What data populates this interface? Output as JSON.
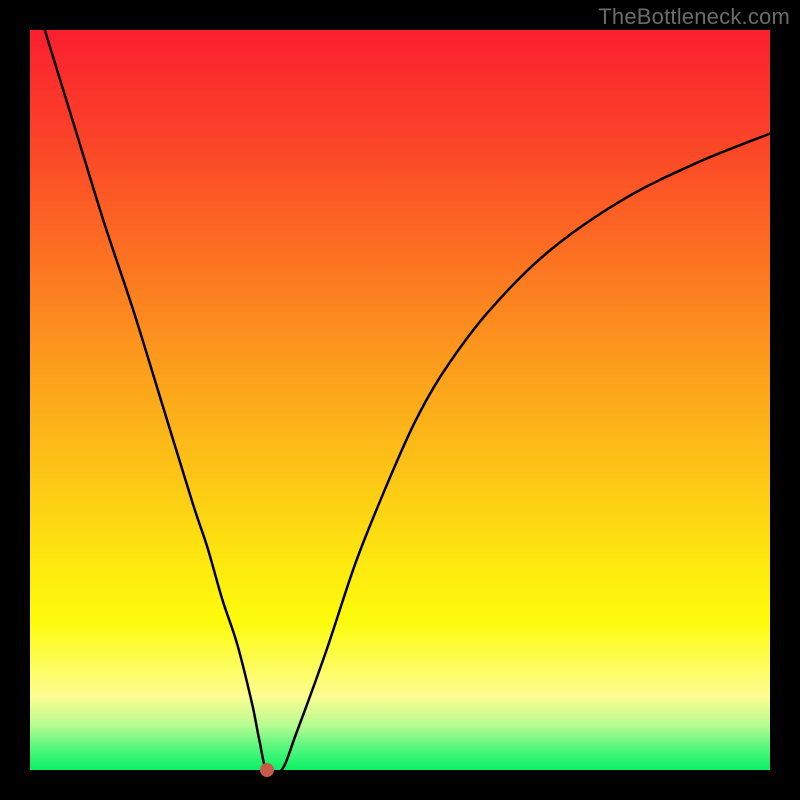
{
  "watermark": "TheBottleneck.com",
  "gradient_colors": {
    "top": "#fb1f2f",
    "upper_mid": "#fc9c1c",
    "mid": "#fdee0e",
    "lower_band": "#fdfd92",
    "green_top": "#54f77d",
    "green_bottom": "#09f167"
  },
  "chart_data": {
    "type": "line",
    "title": "",
    "xlabel": "",
    "ylabel": "",
    "xlim": [
      0,
      100
    ],
    "ylim": [
      0,
      100
    ],
    "grid": false,
    "legend": false,
    "series": [
      {
        "name": "curve",
        "x": [
          2,
          6,
          10,
          14,
          18,
          22,
          24,
          26,
          28,
          30,
          31,
          32,
          34,
          36,
          40,
          44,
          48,
          52,
          56,
          62,
          70,
          80,
          90,
          100
        ],
        "values": [
          100,
          87,
          74,
          62,
          49,
          36,
          30,
          23,
          17,
          9,
          4,
          0,
          0,
          5,
          16,
          28,
          38,
          47,
          54,
          62,
          70,
          77,
          82,
          86
        ]
      }
    ],
    "marker": {
      "x": 32,
      "y": 0,
      "color": "#c95a4a"
    },
    "notes": "Values estimated from pixel positions; y=0 at bottom (green), y=100 at top (red). V-shaped dip bottoms out near x≈31–32 with a short flat segment, then rises as a concave curve toward the right edge."
  }
}
